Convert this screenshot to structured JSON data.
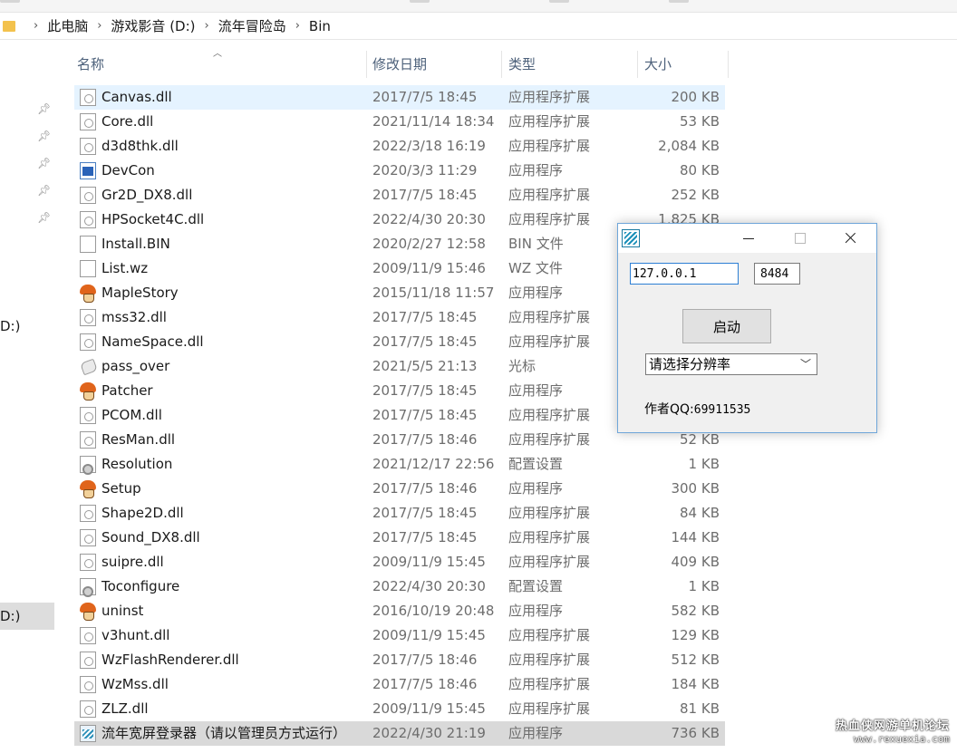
{
  "address": {
    "crumbs": [
      "此电脑",
      "游戏影音 (D:)",
      "流年冒险岛",
      "Bin"
    ]
  },
  "nav": {
    "drive_label_1": "D:)",
    "drive_label_2": "D:)"
  },
  "columns": {
    "name": "名称",
    "date": "修改日期",
    "type": "类型",
    "size": "大小"
  },
  "files": [
    {
      "name": "Canvas.dll",
      "date": "2017/7/5 18:45",
      "type": "应用程序扩展",
      "size": "200 KB",
      "icon": "dll-icon"
    },
    {
      "name": "Core.dll",
      "date": "2021/11/14 18:34",
      "type": "应用程序扩展",
      "size": "53 KB",
      "icon": "dll-icon"
    },
    {
      "name": "d3d8thk.dll",
      "date": "2022/3/18 16:19",
      "type": "应用程序扩展",
      "size": "2,084 KB",
      "icon": "dll-icon"
    },
    {
      "name": "DevCon",
      "date": "2020/3/3 11:29",
      "type": "应用程序",
      "size": "80 KB",
      "icon": "exe-icon"
    },
    {
      "name": "Gr2D_DX8.dll",
      "date": "2017/7/5 18:45",
      "type": "应用程序扩展",
      "size": "252 KB",
      "icon": "dll-icon"
    },
    {
      "name": "HPSocket4C.dll",
      "date": "2022/4/30 20:30",
      "type": "应用程序扩展",
      "size": "1,825 KB",
      "icon": "dll-icon"
    },
    {
      "name": "Install.BIN",
      "date": "2020/2/27 12:58",
      "type": "BIN 文件",
      "size": "",
      "icon": "file-icon"
    },
    {
      "name": "List.wz",
      "date": "2009/11/9 15:46",
      "type": "WZ 文件",
      "size": "",
      "icon": "file-icon"
    },
    {
      "name": "MapleStory",
      "date": "2015/11/18 11:57",
      "type": "应用程序",
      "size": "",
      "icon": "mushroom-icon"
    },
    {
      "name": "mss32.dll",
      "date": "2017/7/5 18:45",
      "type": "应用程序扩展",
      "size": "",
      "icon": "dll-icon"
    },
    {
      "name": "NameSpace.dll",
      "date": "2017/7/5 18:45",
      "type": "应用程序扩展",
      "size": "",
      "icon": "dll-icon"
    },
    {
      "name": "pass_over",
      "date": "2021/5/5 21:13",
      "type": "光标",
      "size": "",
      "icon": "cursor-icon"
    },
    {
      "name": "Patcher",
      "date": "2017/7/5 18:45",
      "type": "应用程序",
      "size": "",
      "icon": "mushroom-icon"
    },
    {
      "name": "PCOM.dll",
      "date": "2017/7/5 18:45",
      "type": "应用程序扩展",
      "size": "",
      "icon": "dll-icon"
    },
    {
      "name": "ResMan.dll",
      "date": "2017/7/5 18:46",
      "type": "应用程序扩展",
      "size": "52 KB",
      "icon": "dll-icon"
    },
    {
      "name": "Resolution",
      "date": "2021/12/17 22:56",
      "type": "配置设置",
      "size": "1 KB",
      "icon": "config-icon"
    },
    {
      "name": "Setup",
      "date": "2017/7/5 18:46",
      "type": "应用程序",
      "size": "300 KB",
      "icon": "mushroom-icon"
    },
    {
      "name": "Shape2D.dll",
      "date": "2017/7/5 18:45",
      "type": "应用程序扩展",
      "size": "84 KB",
      "icon": "dll-icon"
    },
    {
      "name": "Sound_DX8.dll",
      "date": "2017/7/5 18:45",
      "type": "应用程序扩展",
      "size": "144 KB",
      "icon": "dll-icon"
    },
    {
      "name": "suipre.dll",
      "date": "2009/11/9 15:45",
      "type": "应用程序扩展",
      "size": "409 KB",
      "icon": "dll-icon"
    },
    {
      "name": "Toconfigure",
      "date": "2022/4/30 20:30",
      "type": "配置设置",
      "size": "1 KB",
      "icon": "config-icon"
    },
    {
      "name": "uninst",
      "date": "2016/10/19 20:48",
      "type": "应用程序",
      "size": "582 KB",
      "icon": "mushroom-icon"
    },
    {
      "name": "v3hunt.dll",
      "date": "2009/11/9 15:45",
      "type": "应用程序扩展",
      "size": "129 KB",
      "icon": "dll-icon"
    },
    {
      "name": "WzFlashRenderer.dll",
      "date": "2017/7/5 18:46",
      "type": "应用程序扩展",
      "size": "512 KB",
      "icon": "dll-icon"
    },
    {
      "name": "WzMss.dll",
      "date": "2017/7/5 18:46",
      "type": "应用程序扩展",
      "size": "184 KB",
      "icon": "dll-icon"
    },
    {
      "name": "ZLZ.dll",
      "date": "2009/11/9 15:45",
      "type": "应用程序扩展",
      "size": "81 KB",
      "icon": "dll-icon"
    },
    {
      "name": "流年宽屏登录器（请以管理员方式运行）",
      "date": "2022/4/30 21:19",
      "type": "应用程序",
      "size": "736 KB",
      "icon": "launcher-icon"
    }
  ],
  "dialog": {
    "ip_value": "127.0.0.1",
    "port_value": "8484",
    "start_label": "启动",
    "resolution_select": "请选择分辨率",
    "author_label": "作者QQ:",
    "author_qq": "69911535"
  },
  "watermark": {
    "line1": "热血侠网游单机论坛",
    "line2": "www.rexuexia.com"
  }
}
